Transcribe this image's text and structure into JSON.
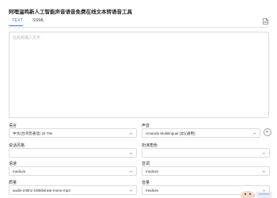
{
  "header": {
    "title": "阿哩温鸣新人工智能声音语音免费在线文本转语音工具"
  },
  "tabs": [
    {
      "label": "TEXT",
      "active": true
    },
    {
      "label": "SSML",
      "active": false
    }
  ],
  "editor": {
    "placeholder": "在此处输入文字"
  },
  "form": {
    "language": {
      "label": "语言",
      "value": "中文(台湾普通话) zh-TW"
    },
    "voice": {
      "label": "声音",
      "value": "Amanda Multilingual (女)(通用)"
    },
    "style": {
      "label": "说话风格",
      "value": ""
    },
    "role": {
      "label": "扮演角色",
      "value": ""
    },
    "rate": {
      "label": "语速",
      "value": "medium"
    },
    "pitch": {
      "label": "音调",
      "value": "medium"
    },
    "quality": {
      "label": "质量",
      "value": "audio-24khz-160kbitrate-mono-mp3"
    },
    "volume": {
      "label": "音量",
      "value": "medium"
    }
  },
  "icons": {
    "doc": "document-icon",
    "play": "play-icon",
    "chevron": "chevron-down-icon"
  },
  "colors": {
    "accent": "#3a7bd5",
    "border": "#dcdcdc"
  }
}
